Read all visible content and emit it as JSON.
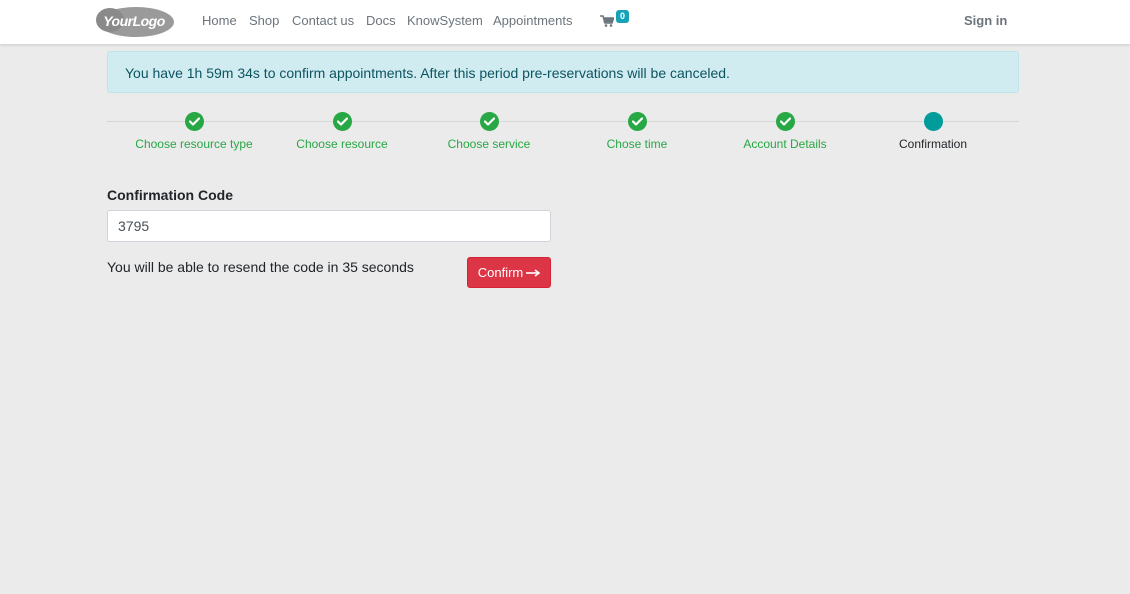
{
  "header": {
    "logo": "YourLogo",
    "nav": [
      "Home",
      "Shop",
      "Contact us",
      "Docs",
      "KnowSystem",
      "Appointments"
    ],
    "cart_count": "0",
    "cart_icon": "shopping-cart-icon",
    "signin_label": "Sign in"
  },
  "alert": {
    "text": "You have 1h 59m 34s to confirm appointments. After this period pre-reservations will be canceled."
  },
  "steps": [
    {
      "label": "Choose resource type",
      "state": "done"
    },
    {
      "label": "Choose resource",
      "state": "done"
    },
    {
      "label": "Choose service",
      "state": "done"
    },
    {
      "label": "Chose time",
      "state": "done"
    },
    {
      "label": "Account Details",
      "state": "done"
    },
    {
      "label": "Confirmation",
      "state": "current"
    }
  ],
  "form": {
    "label": "Confirmation Code",
    "code_value": "3795",
    "resend_text": "You will be able to resend the code in 35 seconds",
    "confirm_label": "Confirm",
    "confirm_icon": "arrow-right-icon"
  },
  "colors": {
    "success": "#28a745",
    "current_step": "#009b9b",
    "danger": "#dc3545",
    "alert_bg": "#d1ecf1",
    "badge": "#17a2b8"
  }
}
